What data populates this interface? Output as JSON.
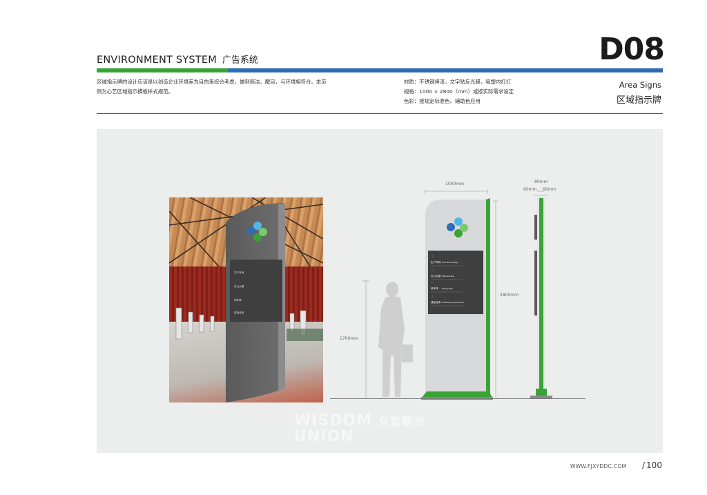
{
  "header": {
    "title_en": "ENVIRONMENT SYSTEM",
    "title_cn": "广告系统",
    "code": "D08"
  },
  "description": {
    "line1": "区域指示牌的设计应该是以创造企业环境美为目的来综合考虑，做到简洁、醒目，与环境相符合。本范",
    "line2": "例为心艺区域指示横板样式规范。"
  },
  "specs": {
    "material": "材质：不锈钢烤漆，文字贴反光膜，吸塑内打灯",
    "size": "规格：1000 × 2800（mm）或按实际需求设定",
    "color": "色彩：按规定标准色、辅助色应用"
  },
  "subtitle": {
    "en": "Area Signs",
    "cn": "区域指示牌"
  },
  "sign": {
    "items": [
      {
        "cn": "生产车间",
        "en": "Production building"
      },
      {
        "cn": "办公大楼",
        "en": "Office building"
      },
      {
        "cn": "停车场",
        "en": "Parking place"
      },
      {
        "cn": "成品仓库",
        "en": "Finished goods warehouse"
      }
    ]
  },
  "dimensions": {
    "width": "1000mm",
    "height": "2800mm",
    "person": "1700mm",
    "depth": "80mm",
    "side_left": "60mm",
    "side_right": "60mm"
  },
  "watermark": {
    "line1": "WISDOM",
    "line1_cn": "众智联合",
    "line2": "UNION"
  },
  "footer": {
    "url": "WWW.FJXYDDC.COM",
    "page": "100"
  },
  "colors": {
    "green": "#3aa336",
    "blue": "#2e6db4",
    "sign_dark": "#3f3f3f",
    "sign_light": "#d8d9da"
  }
}
